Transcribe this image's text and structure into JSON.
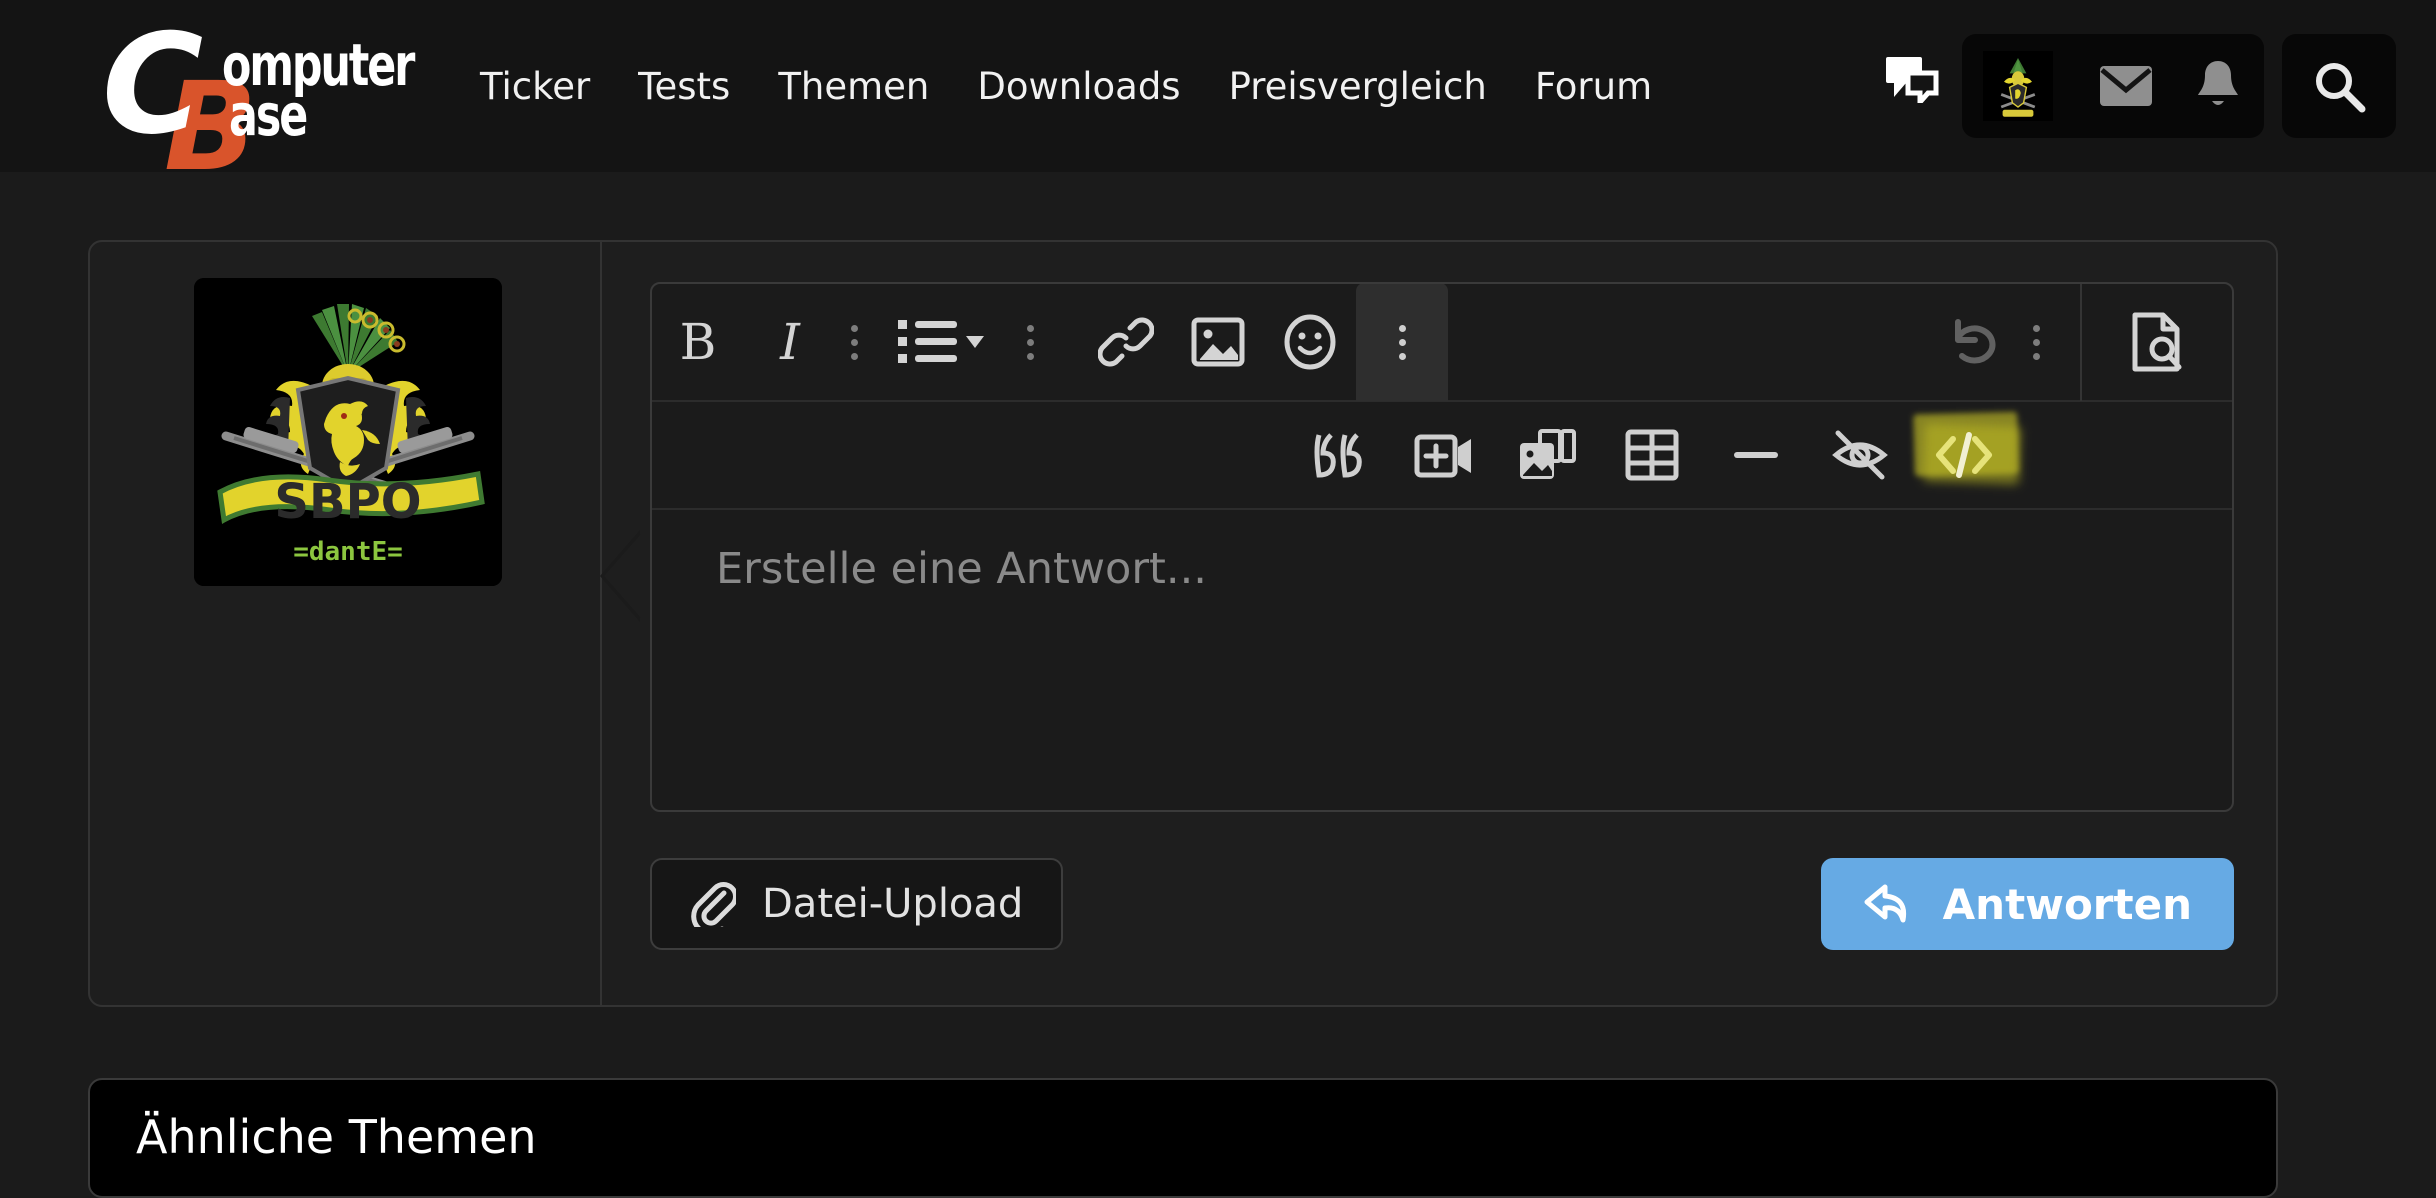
{
  "site": {
    "brand_line1": "omputer",
    "brand_line2": "ase",
    "brand_c": "C",
    "brand_b": "B",
    "brand_color_white": "#ffffff",
    "brand_color_orange": "#d9542b"
  },
  "header": {
    "nav": [
      {
        "label": "Ticker",
        "name": "nav-ticker"
      },
      {
        "label": "Tests",
        "name": "nav-tests"
      },
      {
        "label": "Themen",
        "name": "nav-themen"
      },
      {
        "label": "Downloads",
        "name": "nav-downloads"
      },
      {
        "label": "Preisvergleich",
        "name": "nav-preisvergleich"
      },
      {
        "label": "Forum",
        "name": "nav-forum"
      }
    ],
    "icons": {
      "chat": "chat-bubbles-icon",
      "avatar": "user-avatar-icon",
      "mail": "mail-icon",
      "bell": "bell-icon",
      "search": "search-icon"
    }
  },
  "post": {
    "avatar_alt": "SBPO =dantE= coat of arms avatar",
    "avatar_text_main": "SBPO",
    "avatar_text_sub": "=dantE="
  },
  "editor": {
    "toolbar_row1": [
      {
        "name": "bold-button",
        "icon": "bold-icon",
        "label": "B",
        "state": "normal"
      },
      {
        "name": "italic-button",
        "icon": "italic-icon",
        "label": "I",
        "state": "normal"
      },
      {
        "name": "toolbar-separator-1",
        "icon": "vertical-dots-icon",
        "label": "",
        "state": "separator"
      },
      {
        "name": "list-button",
        "icon": "bullet-list-dropdown-icon",
        "label": "",
        "state": "normal"
      },
      {
        "name": "toolbar-separator-2",
        "icon": "vertical-dots-icon",
        "label": "",
        "state": "separator"
      },
      {
        "name": "link-button",
        "icon": "link-icon",
        "label": "",
        "state": "normal"
      },
      {
        "name": "image-button",
        "icon": "image-icon",
        "label": "",
        "state": "normal"
      },
      {
        "name": "emoji-button",
        "icon": "smiley-icon",
        "label": "",
        "state": "normal"
      },
      {
        "name": "more-options-button",
        "icon": "vertical-dots-icon",
        "label": "",
        "state": "active"
      },
      {
        "name": "undo-button",
        "icon": "undo-icon",
        "label": "",
        "state": "disabled"
      },
      {
        "name": "toolbar-separator-3",
        "icon": "vertical-dots-icon",
        "label": "",
        "state": "separator"
      },
      {
        "name": "preview-button",
        "icon": "document-preview-icon",
        "label": "",
        "state": "normal"
      }
    ],
    "toolbar_row2": [
      {
        "name": "quote-button",
        "icon": "quote-icon"
      },
      {
        "name": "insert-video-button",
        "icon": "add-video-icon"
      },
      {
        "name": "media-gallery-button",
        "icon": "gallery-icon"
      },
      {
        "name": "table-button",
        "icon": "table-icon"
      },
      {
        "name": "horizontal-rule-button",
        "icon": "horizontal-rule-icon"
      },
      {
        "name": "spoiler-button",
        "icon": "eye-off-icon"
      },
      {
        "name": "code-button",
        "icon": "code-icon",
        "highlighted": true
      }
    ],
    "placeholder": "Erstelle eine Antwort...",
    "upload_label": "Datei-Upload",
    "reply_label": "Antworten",
    "reply_button_color": "#66aae4"
  },
  "bottom": {
    "similar_topics_title": "Ähnliche Themen"
  }
}
